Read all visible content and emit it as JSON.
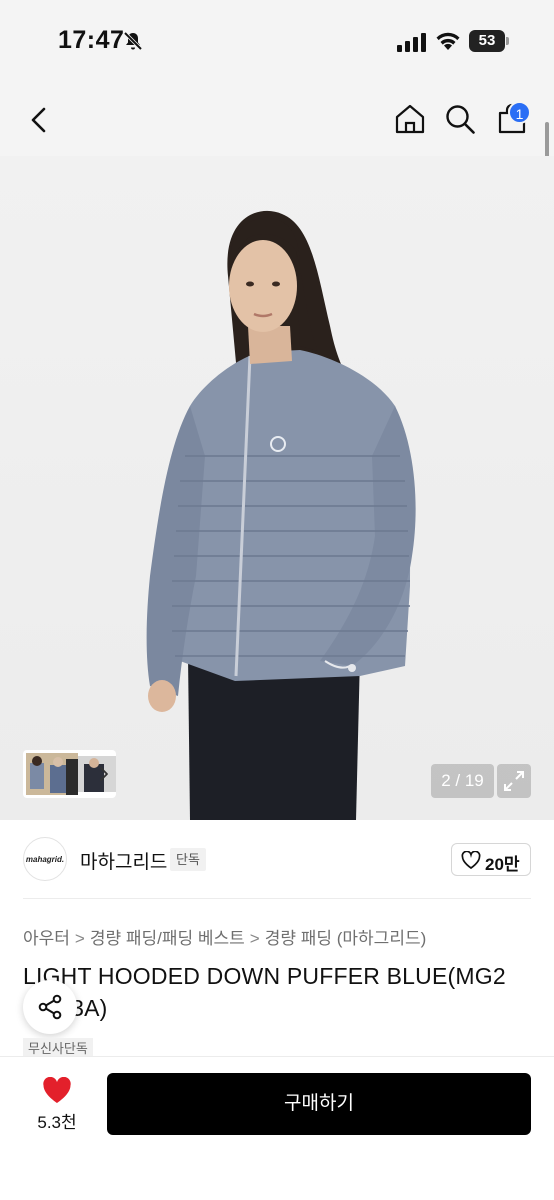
{
  "status_bar": {
    "time": "17:47",
    "battery": "53"
  },
  "header": {
    "cart_count": "1"
  },
  "gallery": {
    "page_counter": "2 / 19"
  },
  "brand": {
    "logo_text": "mahagrid.",
    "name": "마하그리드",
    "exclusive_tag": "단독",
    "like_count": "20만"
  },
  "breadcrumb": {
    "items": [
      "아우터",
      "경량 패딩/패딩 베스트",
      "경량 패딩 (마하그리드)"
    ],
    "separator": ">"
  },
  "product": {
    "title": "LIGHT HOODED DOWN PUFFER BLUE(MG2\n  IB903A)",
    "store_tag": "무신사단독"
  },
  "bottom_bar": {
    "wish_count": "5.3천",
    "buy_label": "구매하기"
  },
  "colors": {
    "accent_badge": "#2a6ef5",
    "heart": "#e3202b",
    "buy_button": "#000000"
  }
}
